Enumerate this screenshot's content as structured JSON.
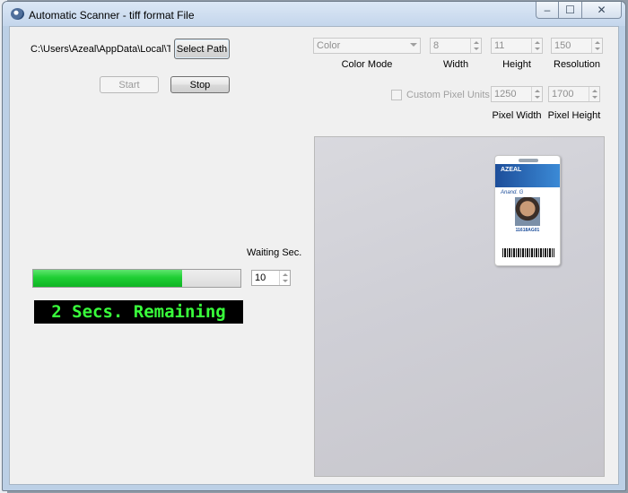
{
  "window": {
    "title": "Automatic Scanner  - tiff format File",
    "minimize_glyph": "–",
    "maximize_glyph": "☐",
    "close_glyph": "✕"
  },
  "path": {
    "value": "C:\\Users\\Azeal\\AppData\\Local\\Temp",
    "select_label": "Select Path"
  },
  "controls": {
    "start_label": "Start",
    "stop_label": "Stop"
  },
  "scan_settings": {
    "color_mode": {
      "value": "Color",
      "label": "Color Mode"
    },
    "width": {
      "value": "8",
      "label": "Width"
    },
    "height": {
      "value": "11",
      "label": "Height"
    },
    "resolution": {
      "value": "150",
      "label": "Resolution"
    },
    "custom_pixel_units_label": "Custom Pixel Units",
    "custom_pixel_units_checked": false,
    "pixel_width": {
      "value": "1250",
      "label": "Pixel Width"
    },
    "pixel_height": {
      "value": "1700",
      "label": "Pixel Height"
    }
  },
  "timer": {
    "waiting_label": "Waiting Sec.",
    "waiting_value": "10",
    "progress_fraction": 0.72,
    "status_text": "2 Secs. Remaining",
    "progress_color": "#1fcf34",
    "status_color": "#39ff3b"
  },
  "preview": {
    "card_brand": "AZEAL",
    "card_name": "Anand. G",
    "card_code": "11618AG01"
  }
}
